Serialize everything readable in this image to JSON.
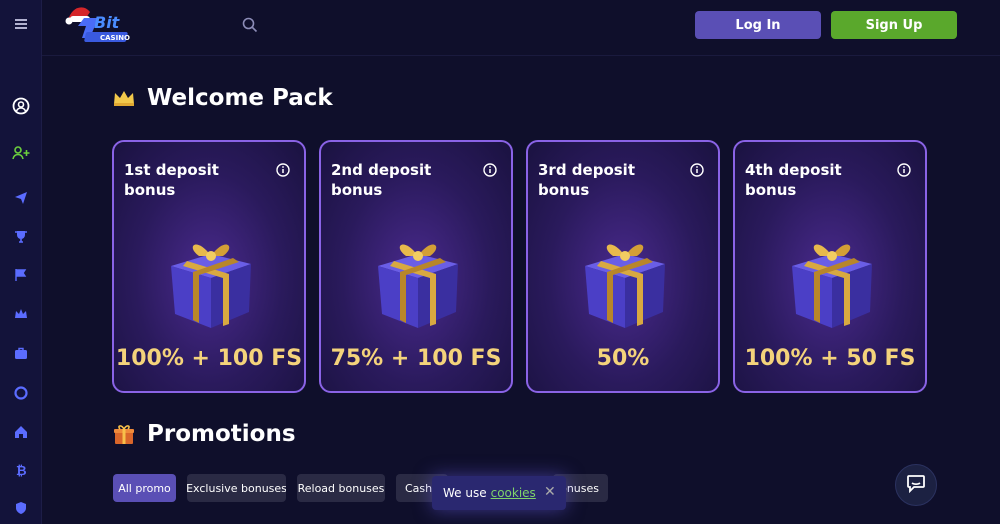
{
  "topbar": {
    "logo_text": "Bit Casino",
    "login_label": "Log In",
    "signup_label": "Sign Up"
  },
  "sidebar": {
    "items": [
      "menu-icon",
      "user-circle-icon",
      "add-user-icon",
      "paper-plane-icon",
      "trophy-icon",
      "flag-icon",
      "crown-icon",
      "briefcase-icon",
      "lifebuoy-icon",
      "home-icon",
      "bitcoin-icon",
      "shield-icon"
    ]
  },
  "welcome": {
    "title": "Welcome Pack",
    "cards": [
      {
        "title": "1st deposit bonus",
        "value": "100% + 100 FS"
      },
      {
        "title": "2nd deposit bonus",
        "value": "75% + 100 FS"
      },
      {
        "title": "3rd deposit bonus",
        "value": "50%"
      },
      {
        "title": "4th deposit bonus",
        "value": "100% + 50 FS"
      }
    ]
  },
  "promotions": {
    "title": "Promotions",
    "chips": [
      "All promo",
      "Exclusive bonuses",
      "Reload bonuses",
      "Cashb",
      "bonuses"
    ]
  },
  "cookie": {
    "text": "We use",
    "link": "cookies",
    "close": "✕"
  },
  "colors": {
    "background": "#0f0f2b",
    "accent_purple": "#5a4fb5",
    "signup_green": "#5aa82c",
    "card_border": "#8a63e6",
    "bonus_gold": "#f4d37b"
  }
}
